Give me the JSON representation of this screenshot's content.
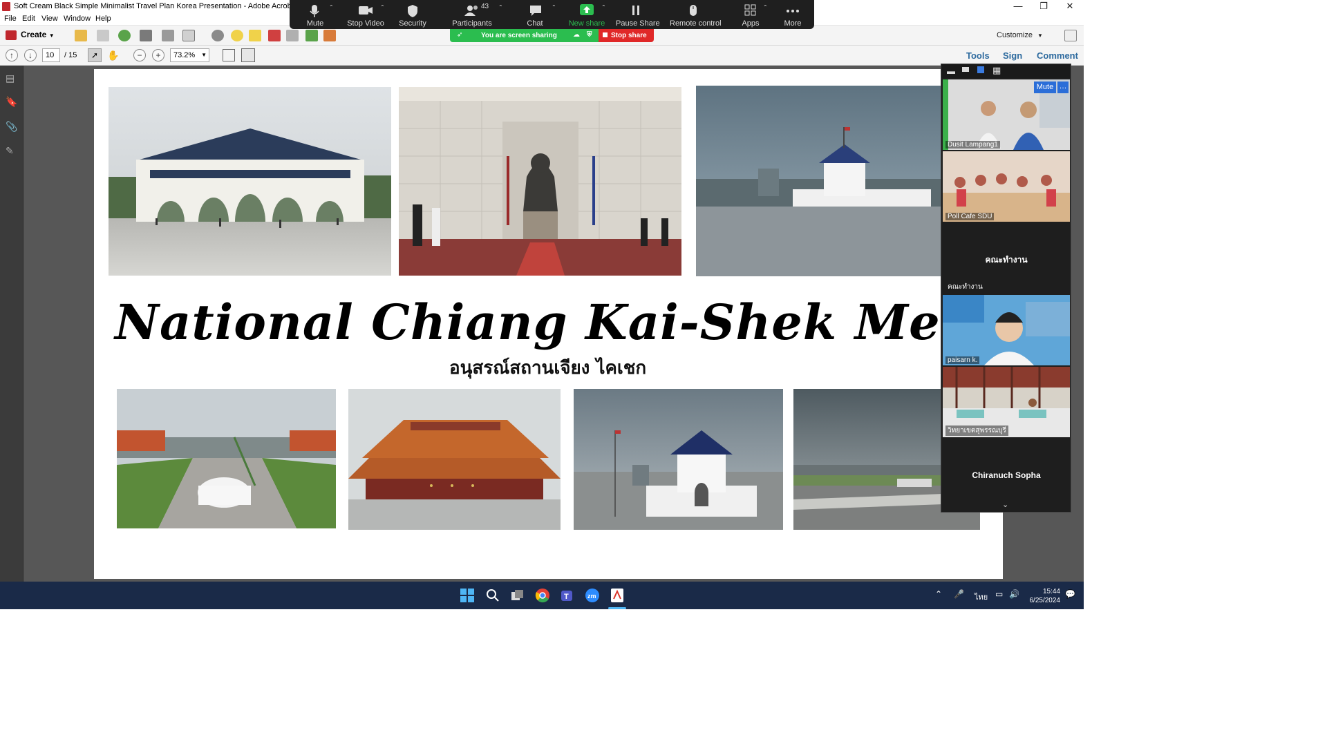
{
  "window": {
    "title": "Soft Cream Black Simple Minimalist Travel Plan Korea Presentation - Adobe Acrobat Pro"
  },
  "menu": [
    "File",
    "Edit",
    "View",
    "Window",
    "Help"
  ],
  "toolbar": {
    "create_label": "Create",
    "customize_label": "Customize"
  },
  "nav": {
    "page_current": "10",
    "page_total": "/ 15",
    "zoom": "73.2%",
    "tools_label": "Tools",
    "sign_label": "Sign",
    "comment_label": "Comment"
  },
  "slide": {
    "title": "National Chiang Kai-Shek Memorial Ha",
    "subtitle": "อนุสรณ์สถานเจียง ไคเชก"
  },
  "zoom_meeting": {
    "controls": [
      {
        "label": "Mute",
        "icon": "microphone-icon"
      },
      {
        "label": "Stop Video",
        "icon": "video-camera-icon"
      },
      {
        "label": "Security",
        "icon": "shield-icon"
      },
      {
        "label": "Participants",
        "icon": "participants-icon",
        "count": "43"
      },
      {
        "label": "Chat",
        "icon": "chat-bubble-icon"
      },
      {
        "label": "New share",
        "icon": "share-arrow-icon"
      },
      {
        "label": "Pause Share",
        "icon": "pause-icon"
      },
      {
        "label": "Remote control",
        "icon": "mouse-icon"
      },
      {
        "label": "Apps",
        "icon": "apps-icon"
      },
      {
        "label": "More",
        "icon": "more-dots-icon"
      }
    ],
    "sharing_banner": "You are screen sharing",
    "stop_share_label": "Stop share",
    "mute_label": "Mute",
    "participants": [
      {
        "name": "Dusit Lampang1",
        "type": "video"
      },
      {
        "name": "Poll Cafe SDU",
        "type": "video"
      },
      {
        "name": "คณะทำงาน",
        "display": "คณะทำงาน",
        "type": "name"
      },
      {
        "name": "paisarn k.",
        "type": "video"
      },
      {
        "name": "วิทยาเขตสุพรรณบุรี",
        "type": "video"
      },
      {
        "name": "Chiranuch Sopha",
        "display": "Chiranuch Sopha",
        "type": "name"
      }
    ]
  },
  "taskbar": {
    "lang": "ไทย",
    "time": "15:44",
    "date": "6/25/2024"
  },
  "colors": {
    "zoom_green": "#2bbd4f",
    "zoom_red": "#e02828",
    "acrobat_link_blue": "#2d6a9e",
    "taskbar_bg": "#1a2a48"
  }
}
